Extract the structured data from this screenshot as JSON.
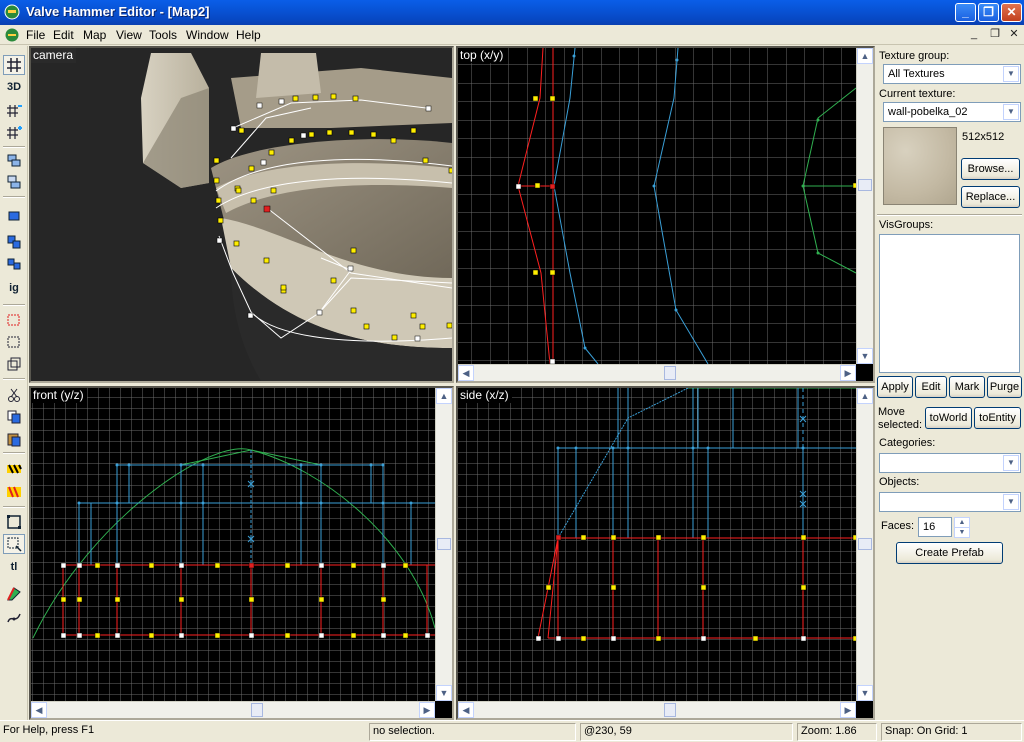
{
  "window": {
    "title": "Valve Hammer Editor - [Map2]",
    "minimize": "_",
    "maximize": "❐",
    "close": "✕"
  },
  "menu": {
    "items": [
      "File",
      "Edit",
      "Map",
      "View",
      "Tools",
      "Window",
      "Help"
    ],
    "mdi_minimize": "_",
    "mdi_restore": "❐",
    "mdi_close": "✕"
  },
  "toolbar": {
    "tools": [
      "grid-toggle-icon",
      "3d-grid-icon",
      "grid-smaller-icon",
      "grid-larger-icon",
      "carve-icon",
      "hollow-icon",
      "group-icon",
      "ungroup-icon",
      "tie-to-entity-icon",
      "ignore-groups-icon",
      "hide-selection-icon",
      "hide-unselected-icon",
      "show-all-icon",
      "cut-icon",
      "copy-icon",
      "paste-icon",
      "texture-lock-icon",
      "texture-scale-icon",
      "selection-tool-icon",
      "magnify-tool-icon",
      "toggle-texture-lock-icon",
      "clip-tool-icon",
      "vertex-tool-icon"
    ],
    "ig_label": "ig",
    "tl_label": "tl",
    "threed_label": "3D"
  },
  "viewports": {
    "camera": {
      "label": "camera"
    },
    "top": {
      "label": "top (x/y)"
    },
    "front": {
      "label": "front (y/z)"
    },
    "side": {
      "label": "side (x/z)"
    }
  },
  "panel": {
    "texture_group_label": "Texture group:",
    "texture_group_value": "All Textures",
    "current_texture_label": "Current texture:",
    "current_texture_value": "wall-pobelka_02",
    "texture_size": "512x512",
    "browse_button": "Browse...",
    "replace_button": "Replace...",
    "visgroups_label": "VisGroups:",
    "apply_button": "Apply",
    "edit_button": "Edit",
    "mark_button": "Mark",
    "purge_button": "Purge",
    "move_selected_label": "Move selected:",
    "to_world_button": "toWorld",
    "to_entity_button": "toEntity",
    "categories_label": "Categories:",
    "categories_value": "",
    "objects_label": "Objects:",
    "objects_value": "",
    "faces_label": "Faces:",
    "faces_value": "16",
    "create_prefab_button": "Create Prefab"
  },
  "status": {
    "help": "For Help, press F1",
    "selection": "no selection.",
    "coords": "@230, 59",
    "zoom": "Zoom: 1.86",
    "snap": "Snap: On Grid: 1"
  },
  "colors": {
    "title_bar": "#0853d6",
    "brush_red": "#ff2020",
    "brush_cyan": "#3aa0d8",
    "brush_green": "#30b050",
    "vertex_yellow": "#ffee00",
    "grid": "#6a6a6a"
  }
}
